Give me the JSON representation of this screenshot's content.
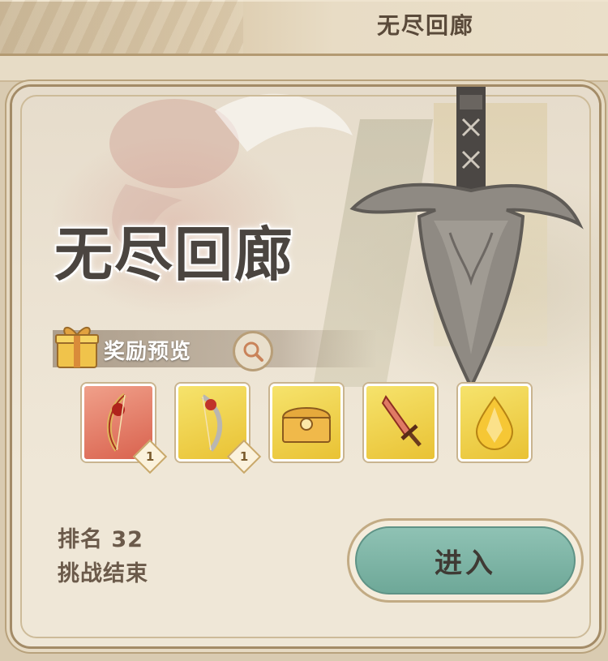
{
  "header": {
    "title": "无尽回廊"
  },
  "card": {
    "title": "无尽回廊",
    "reward_preview_label": "奖励预览",
    "rewards": [
      {
        "icon": "red-bow-item-icon",
        "rarity": "red",
        "quantity": "1"
      },
      {
        "icon": "silver-bow-item-icon",
        "rarity": "gold",
        "quantity": "1"
      },
      {
        "icon": "treasure-chest-icon",
        "rarity": "gold",
        "quantity": ""
      },
      {
        "icon": "dagger-icon",
        "rarity": "gold",
        "quantity": ""
      },
      {
        "icon": "amber-crystal-icon",
        "rarity": "gold",
        "quantity": ""
      }
    ],
    "rank_text": "排名 32",
    "status_text": "挑战结束",
    "enter_button_label": "进入"
  },
  "colors": {
    "accent_teal": "#6ea898",
    "text_brown": "#6b5a4a",
    "frame": "#a38b67"
  }
}
